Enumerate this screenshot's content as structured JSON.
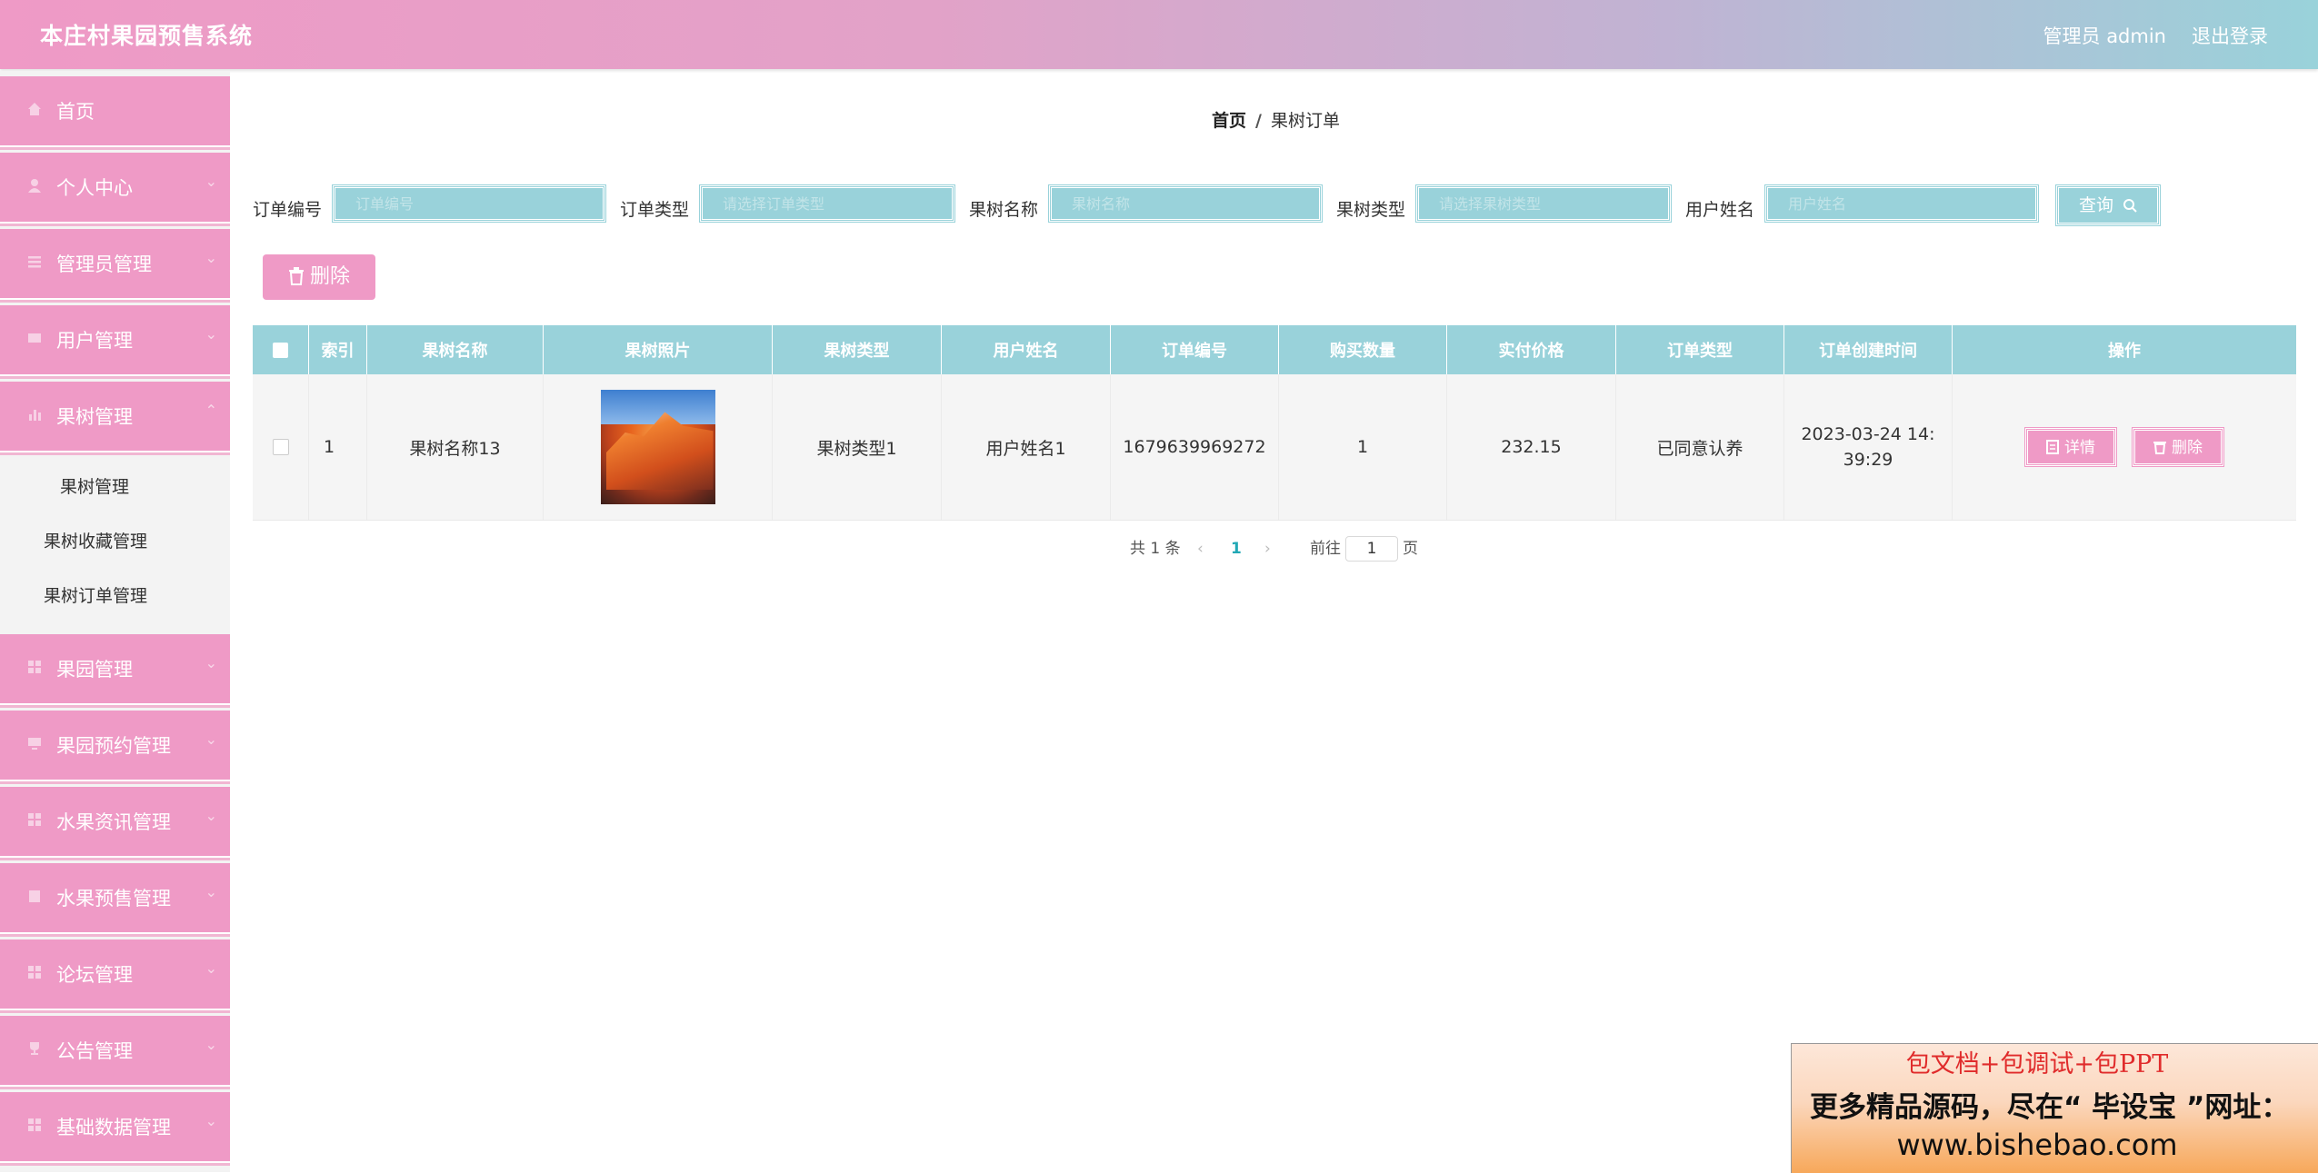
{
  "header": {
    "title": "本庄村果园预售系统",
    "user": "管理员 admin",
    "logout": "退出登录"
  },
  "sidebar": {
    "items": [
      {
        "label": "首页",
        "icon": "home-icon"
      },
      {
        "label": "个人中心",
        "icon": "user-icon"
      },
      {
        "label": "管理员管理",
        "icon": "list-icon"
      },
      {
        "label": "用户管理",
        "icon": "id-card-icon"
      },
      {
        "label": "果树管理",
        "icon": "bar-chart-icon"
      },
      {
        "label": "果园管理",
        "icon": "grid-icon"
      },
      {
        "label": "果园预约管理",
        "icon": "monitor-icon"
      },
      {
        "label": "水果资讯管理",
        "icon": "grid-icon"
      },
      {
        "label": "水果预售管理",
        "icon": "clipboard-icon"
      },
      {
        "label": "论坛管理",
        "icon": "grid-icon"
      },
      {
        "label": "公告管理",
        "icon": "trophy-icon"
      },
      {
        "label": "基础数据管理",
        "icon": "grid-icon"
      }
    ],
    "subitems": [
      "果树管理",
      "果树收藏管理",
      "果树订单管理"
    ]
  },
  "breadcrumb": {
    "home": "首页",
    "separator": "/",
    "current": "果树订单"
  },
  "search": {
    "fields": [
      {
        "label": "订单编号",
        "placeholder": "订单编号"
      },
      {
        "label": "订单类型",
        "placeholder": "请选择订单类型"
      },
      {
        "label": "果树名称",
        "placeholder": "果树名称"
      },
      {
        "label": "果树类型",
        "placeholder": "请选择果树类型"
      },
      {
        "label": "用户姓名",
        "placeholder": "用户姓名"
      }
    ],
    "button": "查询"
  },
  "toolbar": {
    "delete_label": "删除"
  },
  "table": {
    "columns": [
      "索引",
      "果树名称",
      "果树照片",
      "果树类型",
      "用户姓名",
      "订单编号",
      "购买数量",
      "实付价格",
      "订单类型",
      "订单创建时间",
      "操作"
    ],
    "rows": [
      {
        "index": "1",
        "name": "果树名称13",
        "type": "果树类型1",
        "user": "用户姓名1",
        "order_no": "1679639969272",
        "qty": "1",
        "price": "232.15",
        "order_type": "已同意认养",
        "created": "2023-03-24 14:39:29",
        "detail_label": "详情",
        "delete_label": "删除"
      }
    ]
  },
  "pagination": {
    "total": "共 1 条",
    "current": "1",
    "goto": "前往",
    "page_input": "1",
    "page_suffix": "页"
  },
  "promo": {
    "line1": "包文档+包调试+包PPT",
    "line2": "更多精品源码，尽在“ 毕设宝 ”网址：",
    "line3": "www.bishebao.com"
  },
  "colors": {
    "pink": "#ef9ac6",
    "teal": "#99d2da",
    "promo_red": "#e02b2b"
  }
}
